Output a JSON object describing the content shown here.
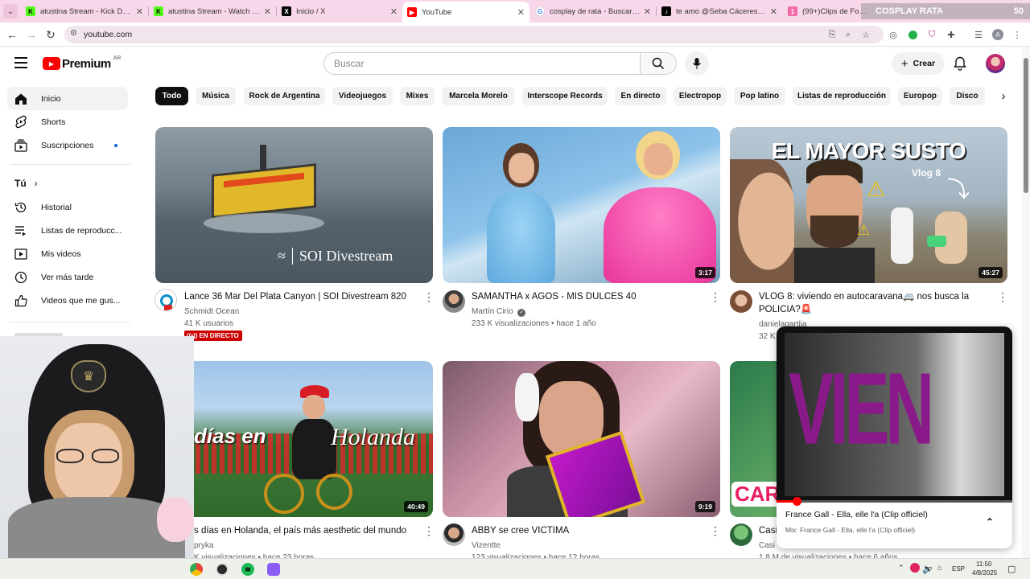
{
  "tabs": [
    {
      "label": "atustina Stream - Kick Dashboard",
      "favicon": "kick-icon",
      "color": "#53fc18"
    },
    {
      "label": "atustina Stream - Watch Live on Kick",
      "favicon": "kick-icon",
      "color": "#53fc18"
    },
    {
      "label": "Inicio / X",
      "favicon": "x-icon",
      "color": "#000000"
    },
    {
      "label": "YouTube",
      "favicon": "youtube-icon",
      "color": "#ff0000",
      "active": true
    },
    {
      "label": "cosplay de rata - Buscar con Google",
      "favicon": "google-icon",
      "color": "#4285f4"
    },
    {
      "label": "te amo @Seba Cáceres | gol de ...",
      "favicon": "tiktok-icon",
      "color": "#000000"
    },
    {
      "label": "(99+)Clips de Fortnite con ...",
      "favicon": "group-icon",
      "color": "#000000"
    }
  ],
  "tab_group": {
    "badge": "1",
    "name": "COSPLAY RATA",
    "count": "50"
  },
  "address": {
    "url": "youtube.com"
  },
  "youtube": {
    "brand": "Premium",
    "region": "AR",
    "search_placeholder": "Buscar",
    "create_label": "Crear"
  },
  "sidebar": {
    "items": [
      {
        "label": "Inicio",
        "icon": "home-icon",
        "active": true
      },
      {
        "label": "Shorts",
        "icon": "shorts-icon"
      },
      {
        "label": "Suscripciones",
        "icon": "subscriptions-icon"
      }
    ],
    "you_heading": "Tú",
    "you_items": [
      {
        "label": "Historial",
        "icon": "history-icon"
      },
      {
        "label": "Listas de reproducc...",
        "icon": "playlist-icon"
      },
      {
        "label": "Mis videos",
        "icon": "video-icon"
      },
      {
        "label": "Ver más tarde",
        "icon": "clock-icon"
      },
      {
        "label": "Videos que me gus...",
        "icon": "like-icon"
      }
    ]
  },
  "chips": [
    "Todo",
    "Música",
    "Rock de Argentina",
    "Videojuegos",
    "Mixes",
    "Marcela Morelo",
    "Interscope Records",
    "En directo",
    "Electropop",
    "Pop latino",
    "Listas de reproducción",
    "Europop",
    "Disco"
  ],
  "videos": [
    {
      "title": "Lance 36 Mar Del Plata Canyon | SOI Divestream 820",
      "channel": "Schmidt Ocean",
      "meta": "41 K usuarios",
      "badge": "EN DIRECTO",
      "overlay": "SOI Divestream",
      "duration": ""
    },
    {
      "title": "SAMANTHA x AGOS - MIS DULCES 40",
      "channel": "Martín Cirio",
      "meta": "233 K visualizaciones • hace 1 año",
      "duration": "3:17",
      "verified": true
    },
    {
      "title": "VLOG 8: viviendo en autocaravana🚐 nos busca la POLICIA?🚨",
      "channel": "danielagartija",
      "meta": "32 K",
      "duration": "45:27",
      "overlay": "EL MAYOR SUSTO",
      "overlay_sub": "Vlog 8"
    },
    {
      "title": "s días en Holanda, el país más aesthetic del mundo",
      "channel": "pryka",
      "meta": "K visualizaciones • hace 23 horas",
      "duration": "40:49",
      "overlay": "días en",
      "overlay2": "Holanda"
    },
    {
      "title": "ABBY se cree VICTIMA",
      "channel": "Vizentte",
      "meta": "123 visualizaciones • hace 12 horas",
      "duration": "9:19"
    },
    {
      "title": "Casi",
      "channel": "Casi",
      "meta": "1.8 M de visualizaciones • hace 6 años",
      "duration": "",
      "overlay": "CAR"
    }
  ],
  "miniplayer": {
    "overlay": "VIEN",
    "title": "France Gall - Ella, elle l'a (Clip officiel)",
    "subtitle": "Mix: France Gall - Ella, elle l'a (Clip officiel)"
  },
  "taskbar": {
    "lang": "ESP",
    "time": "11:50",
    "date": "4/8/2025"
  },
  "colors": {
    "accent_red": "#ff0000",
    "tab_bar": "#f9d7ea",
    "live_red": "#cc0000"
  }
}
